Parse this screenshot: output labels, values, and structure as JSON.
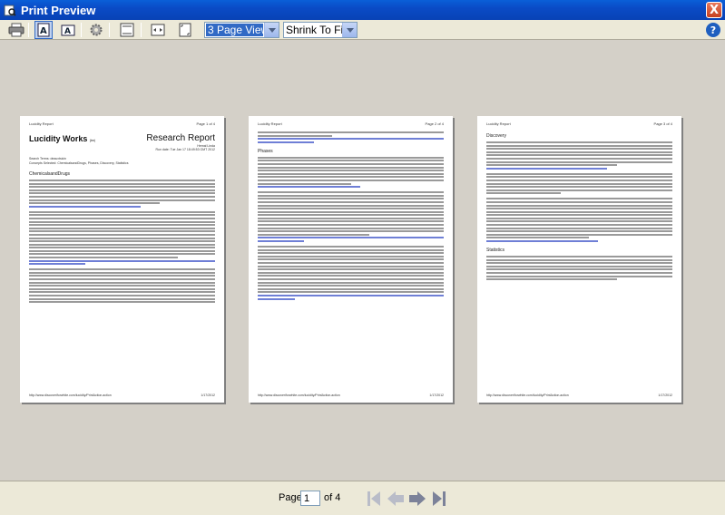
{
  "window": {
    "title": "Print Preview",
    "close_label": "X"
  },
  "toolbar": {
    "view_mode": "3 Page View",
    "zoom": "Shrink To Fit",
    "help_label": "?"
  },
  "pages": [
    {
      "header_left": "Lucidity Report",
      "header_right": "Page 1 of 4",
      "brand": "Lucidity Works",
      "brand_suffix": "(tm)",
      "report_title": "Research Report",
      "meta_right": [
        "Hemal Linda",
        "Run date: Tue Jan 17 18:49:53 GMT 2012"
      ],
      "meta_left": [
        "Search Terms: deauxtsicin",
        "Concepts Selected: ChemicalsandDrugs, Phases, Discovery, Statistics"
      ],
      "section": "ChemicalsandDrugs",
      "footer_left": "http://www.discoveriforwhite.com/lucidity/PrintAction.action",
      "footer_right": "1/17/2012"
    },
    {
      "header_left": "Lucidity Report",
      "header_right": "Page 2 of 4",
      "section": "Phases",
      "footer_left": "http://www.discoveriforwhite.com/lucidity/PrintAction.action",
      "footer_right": "1/17/2012"
    },
    {
      "header_left": "Lucidity Report",
      "header_right": "Page 3 of 4",
      "section": "Discovery",
      "section2": "Statistics",
      "footer_left": "http://www.discoveriforwhite.com/lucidity/PrintAction.action",
      "footer_right": "1/17/2012"
    }
  ],
  "navigation": {
    "page_label": "Page",
    "current_page": "1",
    "of_label": "of 4"
  }
}
